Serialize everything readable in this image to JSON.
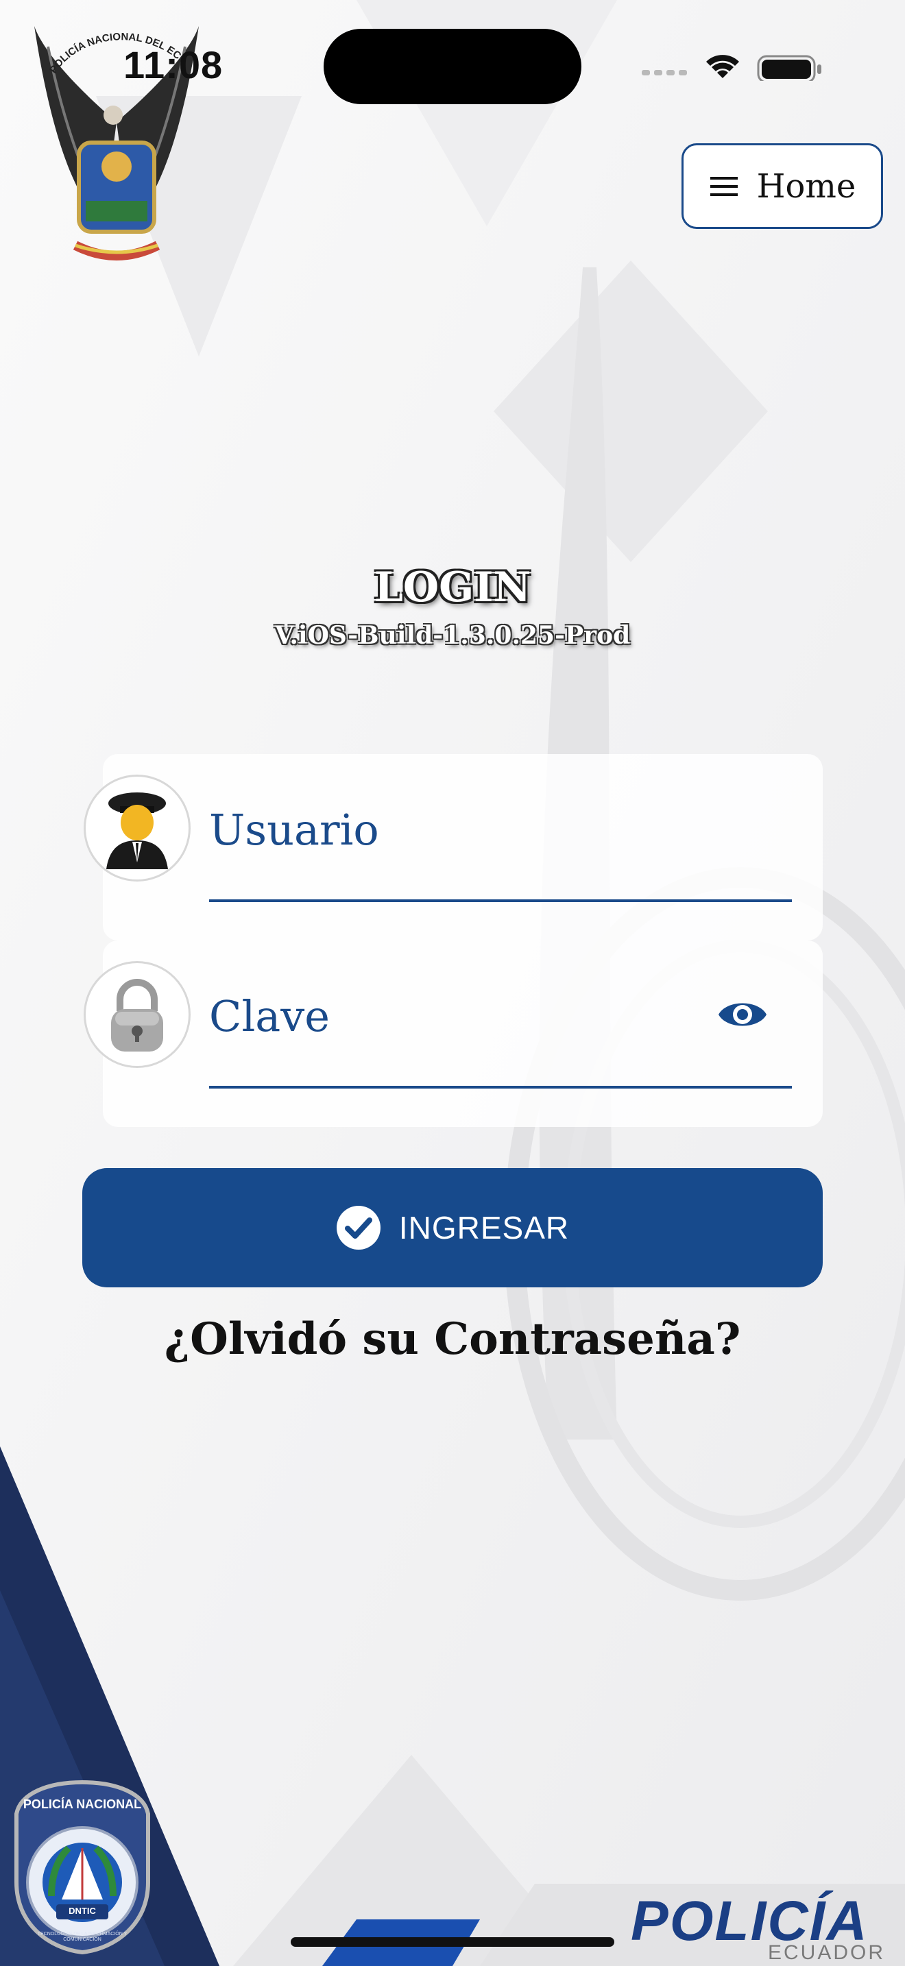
{
  "status_bar": {
    "time": "11:08"
  },
  "header": {
    "crest_text": "POLICÍA NACIONAL DEL ECUADOR",
    "menu_label": "Home"
  },
  "login": {
    "title": "LOGIN",
    "version": "V.iOS-Build-1.3.0.25-Prod",
    "username_placeholder": "Usuario",
    "password_placeholder": "Clave",
    "submit_label": "INGRESAR",
    "forgot_label": "¿Olvidó su Contraseña?"
  },
  "footer": {
    "badge_top": "POLICÍA NACIONAL",
    "badge_ring": "TECNOLOGÍAS DE LA INFORMACIÓN Y COMUNICACIÓN",
    "badge_center": "DNTIC",
    "brand_main": "POLICÍA",
    "brand_sub": "ECUADOR"
  },
  "colors": {
    "primary": "#174a8c",
    "dark_navy": "#1d2f5c",
    "text_dark": "#111111"
  }
}
